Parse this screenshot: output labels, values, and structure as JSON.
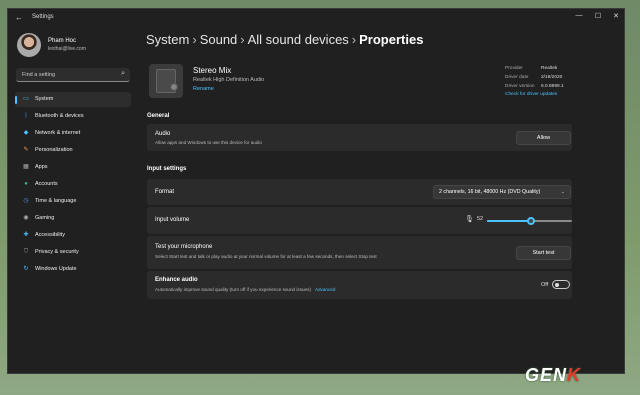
{
  "window": {
    "title": "Settings",
    "back_glyph": "←",
    "minimize_glyph": "—",
    "maximize_glyph": "☐",
    "close_glyph": "✕"
  },
  "user": {
    "name": "Pham Hoc",
    "email": "lexthai@live.com"
  },
  "search": {
    "placeholder": "Find a setting"
  },
  "nav": [
    {
      "label": "System",
      "icon": "monitor-icon",
      "color": "#4cc2ff",
      "glyph": "▭"
    },
    {
      "label": "Bluetooth & devices",
      "icon": "bluetooth-icon",
      "color": "#3b8eea",
      "glyph": "ᛒ"
    },
    {
      "label": "Network & internet",
      "icon": "wifi-icon",
      "color": "#4cc2ff",
      "glyph": "◆"
    },
    {
      "label": "Personalization",
      "icon": "brush-icon",
      "color": "#e8a15a",
      "glyph": "✎"
    },
    {
      "label": "Apps",
      "icon": "apps-icon",
      "color": "#b0b0b0",
      "glyph": "▦"
    },
    {
      "label": "Accounts",
      "icon": "person-icon",
      "color": "#3fb68b",
      "glyph": "●"
    },
    {
      "label": "Time & language",
      "icon": "globe-clock-icon",
      "color": "#4c9be8",
      "glyph": "◷"
    },
    {
      "label": "Gaming",
      "icon": "gamepad-icon",
      "color": "#b0b0b0",
      "glyph": "◉"
    },
    {
      "label": "Accessibility",
      "icon": "accessibility-icon",
      "color": "#4cc2ff",
      "glyph": "✚"
    },
    {
      "label": "Privacy & security",
      "icon": "shield-icon",
      "color": "#9a9a9a",
      "glyph": "⛉"
    },
    {
      "label": "Windows Update",
      "icon": "update-icon",
      "color": "#4cc2ff",
      "glyph": "↻"
    }
  ],
  "breadcrumb": {
    "items": [
      "System",
      "Sound",
      "All sound devices"
    ],
    "current": "Properties",
    "sep": "›"
  },
  "device": {
    "name": "Stereo Mix",
    "subtitle": "Realtek High Definition Audio",
    "rename": "Rename",
    "provider_label": "Provider",
    "provider": "Realtek",
    "driver_date_label": "Driver date",
    "driver_date": "2/18/2020",
    "driver_version_label": "Driver version",
    "driver_version": "6.0.8899.1",
    "update_link": "Check for driver updates"
  },
  "general": {
    "heading": "General",
    "audio_title": "Audio",
    "audio_desc": "Allow apps and Windows to use this device for audio",
    "allow_label": "Allow"
  },
  "input": {
    "heading": "Input settings",
    "format_title": "Format",
    "format_value": "2 channels, 16 bit, 48000 Hz (DVD Quality)",
    "volume_title": "Input volume",
    "volume_value": "52",
    "volume_level": 0.52,
    "test_title": "Test your microphone",
    "test_desc": "Select Start test and talk or play audio at your normal volume for at least a few seconds, then select Stop test",
    "start_test_label": "Start test",
    "enhance_title": "Enhance audio",
    "enhance_desc": "Automatically improve sound quality (turn off if you experience sound issues)",
    "advanced_link": "Advanced",
    "enhance_state": "Off"
  },
  "watermark": {
    "part1": "GEN",
    "part2": "K"
  },
  "colors": {
    "accent": "#4cc2ff",
    "window_bg": "#202020",
    "card_bg": "#2b2b2b"
  }
}
